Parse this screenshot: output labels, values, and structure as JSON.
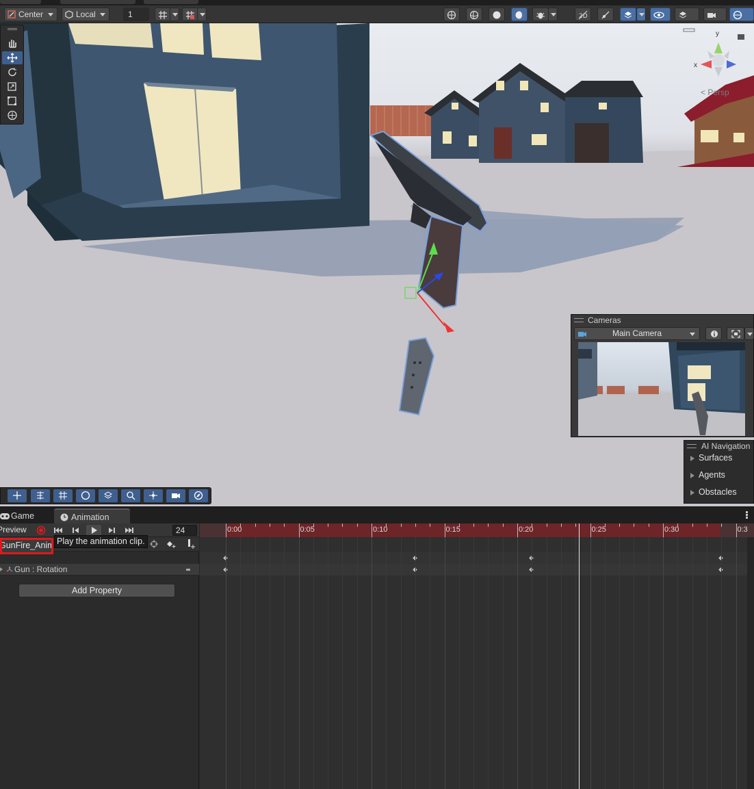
{
  "toolbar": {
    "pivot_label": "Center",
    "space_label": "Local",
    "grid_value": "1"
  },
  "viewport": {
    "persp_label": "< Persp",
    "gizmo_axes": {
      "y": "y",
      "x": "x"
    }
  },
  "cameras_overlay": {
    "title": "Cameras",
    "selected_camera": "Main Camera"
  },
  "ai_navigation": {
    "title": "AI Navigation",
    "items": [
      {
        "label": "Surfaces"
      },
      {
        "label": "Agents"
      },
      {
        "label": "Obstacles"
      }
    ]
  },
  "bottom_tabs": [
    {
      "label": "Game",
      "icon": "gamepad-icon"
    },
    {
      "label": "Animation",
      "icon": "clock-icon"
    }
  ],
  "animation": {
    "preview_label": "Preview",
    "frame_value": "24",
    "clip_name": "GunFire_Anim",
    "tooltip": "Play the animation clip.",
    "property_label": "Gun : Rotation",
    "add_property_label": "Add Property",
    "ruler_labels": [
      "0:00",
      "0:05",
      "0:10",
      "0:15",
      "0:20",
      "0:25",
      "0:30",
      "0:3"
    ],
    "keyframe_times": [
      "0:00",
      "0:13",
      "0:21",
      "0:34"
    ]
  },
  "colors": {
    "accent": "#4a6fa3",
    "record_red": "#e0191c",
    "ruler": "#6d2528"
  }
}
